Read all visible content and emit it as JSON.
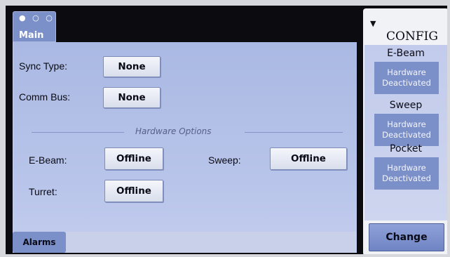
{
  "main_tab": {
    "dots": "● ○ ○",
    "label": "Main"
  },
  "settings": {
    "sync_type": {
      "label": "Sync Type:",
      "value": "None"
    },
    "comm_bus": {
      "label": "Comm Bus:",
      "value": "None"
    }
  },
  "hardware": {
    "title": "Hardware Options",
    "ebeam": {
      "label": "E-Beam:",
      "value": "Offline"
    },
    "sweep": {
      "label": "Sweep:",
      "value": "Offline"
    },
    "turret": {
      "label": "Turret:",
      "value": "Offline"
    }
  },
  "alarms_label": "Alarms",
  "config": {
    "title": "CONFIG",
    "caret": "▼",
    "groups": [
      {
        "title": "E-Beam",
        "status_line1": "Hardware",
        "status_line2": "Deactivated"
      },
      {
        "title": "Sweep",
        "status_line1": "Hardware",
        "status_line2": "Deactivated"
      },
      {
        "title": "Pocket",
        "status_line1": "Hardware",
        "status_line2": "Deactivated"
      }
    ],
    "change_label": "Change"
  }
}
